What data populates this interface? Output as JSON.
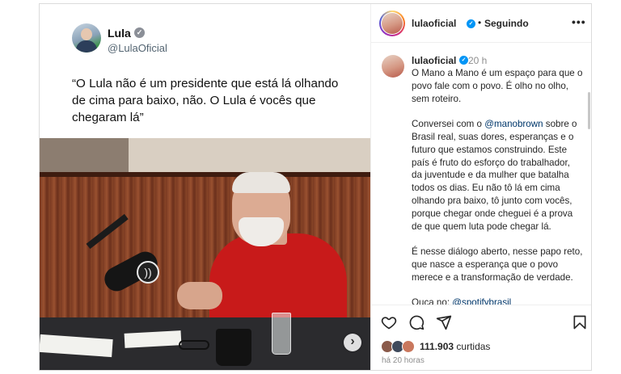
{
  "tweet": {
    "name": "Lula",
    "handle": "@LulaOficial",
    "quote": "“O Lula não é um presidente que está lá olhando de cima para baixo, não. O Lula é vocês que chegaram lá”"
  },
  "header": {
    "username": "lulaoficial",
    "separator": "•",
    "follow_status": "Seguindo",
    "more": "•••"
  },
  "caption": {
    "username": "lulaoficial",
    "time": "20 h",
    "p1": "O Mano a Mano é um espaço para que o povo fale com o povo. É olho no olho, sem roteiro.",
    "p2_before": "Conversei com o ",
    "p2_mention": "@manobrown",
    "p2_after": " sobre o Brasil real, suas dores, esperanças e o futuro que estamos construindo. Este país é fruto do esforço do trabalhador, da juventude e da mulher que batalha todos os dias. Eu não tô lá em cima olhando pra baixo, tô junto com vocês, porque chegar onde cheguei é a prova de que quem luta pode chegar lá.",
    "p3": "É nesse diálogo aberto, nesse papo reto, que nasce a esperança que o povo merece e a transformação de verdade.",
    "p4_before": "Ouça no: ",
    "p4_mention": "@spotifybrasil"
  },
  "actions": {
    "likes_count": "111.903",
    "likes_label": " curtidas",
    "posted": "há 20 horas"
  },
  "icons": [
    "heart-icon",
    "comment-icon",
    "share-icon",
    "bookmark-icon",
    "verified-icon",
    "chevron-right-icon",
    "more-icon",
    "spotify-icon"
  ],
  "colors": {
    "verified": "#0095f6",
    "mention": "#00376b",
    "shirt": "#c81a1a"
  }
}
